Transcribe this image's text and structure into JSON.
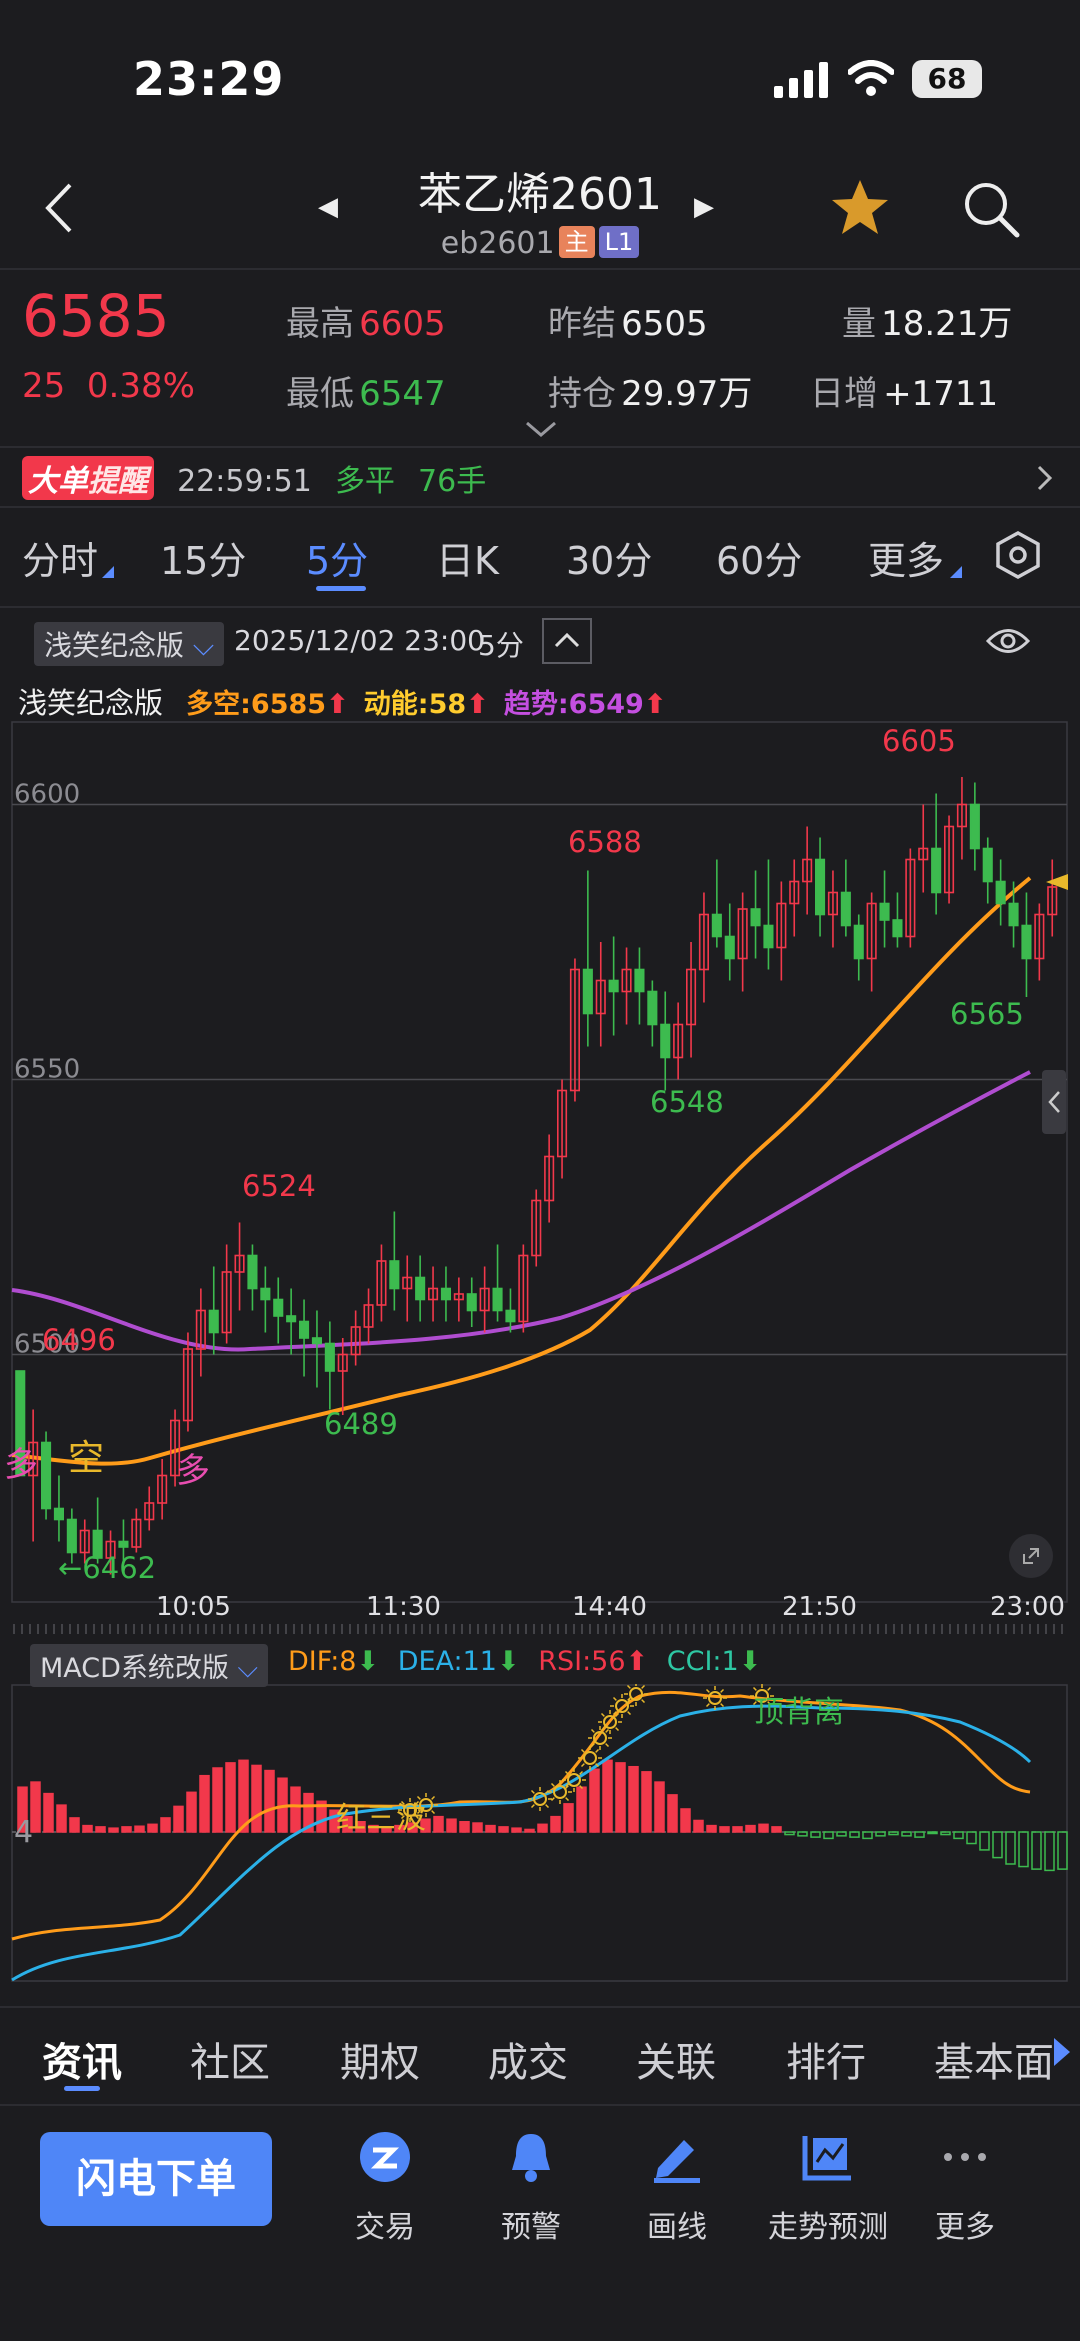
{
  "status_bar": {
    "time": "23:29",
    "battery": "68"
  },
  "header": {
    "title": "苯乙烯2601",
    "contract": "eb2601",
    "tag_main": "主",
    "tag_level": "L1"
  },
  "quote": {
    "last_price": "6585",
    "change": "25",
    "change_pct": "0.38%",
    "high_label": "最高",
    "high": "6605",
    "low_label": "最低",
    "low": "6547",
    "prev_settle_label": "昨结",
    "prev_settle": "6505",
    "open_interest_label": "持仓",
    "open_interest": "29.97万",
    "volume_label": "量",
    "volume": "18.21万",
    "daily_increase_label": "日增",
    "daily_increase": "+1711"
  },
  "alert": {
    "badge_a": "大单",
    "badge_b": "提醒",
    "time": "22:59:51",
    "type": "多平",
    "lots": "76手"
  },
  "period_tabs": [
    "分时",
    "15分",
    "5分",
    "日K",
    "30分",
    "60分",
    "更多"
  ],
  "active_period": "5分",
  "chart_header": {
    "indicator_select": "浅笑纪念版",
    "datetime": "2025/12/02 23:00",
    "period": "5分"
  },
  "legend": {
    "name": "浅笑纪念版",
    "long_short": "多空:6585",
    "momentum": "动能:58",
    "trend": "趋势:6549"
  },
  "chart_data": {
    "type": "candlestick",
    "y_ticks": [
      "6600",
      "6550",
      "6500"
    ],
    "x_ticks": [
      "10:05",
      "11:30",
      "14:40",
      "21:50",
      "23:00"
    ],
    "ylim": [
      6455,
      6615
    ],
    "annotations": {
      "high_6605": "6605",
      "high_6588": "6588",
      "high_6524": "6524",
      "low_6565": "6565",
      "low_6548": "6548",
      "low_6489": "6489",
      "left_6496": "6496",
      "low_6462": "←6462",
      "signal_kong": "空",
      "signal_duo": "多",
      "signal_duo_left": "多"
    },
    "colors": {
      "up": "#f2384b",
      "down": "#3dbb4f",
      "long_short_line": "#ff9c1a",
      "trend_line": "#b04dd0"
    }
  },
  "macd": {
    "select": "MACD系统改版",
    "dif": "DIF:8",
    "dea": "DEA:11",
    "rsi": "RSI:56",
    "cci": "CCI:1",
    "axis_label": "4",
    "annot_red_wave": "红三波",
    "annot_top_div": "顶背离"
  },
  "bottom_tabs": [
    "资讯",
    "社区",
    "期权",
    "成交",
    "关联",
    "排行",
    "基本面"
  ],
  "toolbar": {
    "order": "闪电下单",
    "items": [
      "交易",
      "预警",
      "画线",
      "走势预测",
      "更多"
    ]
  }
}
